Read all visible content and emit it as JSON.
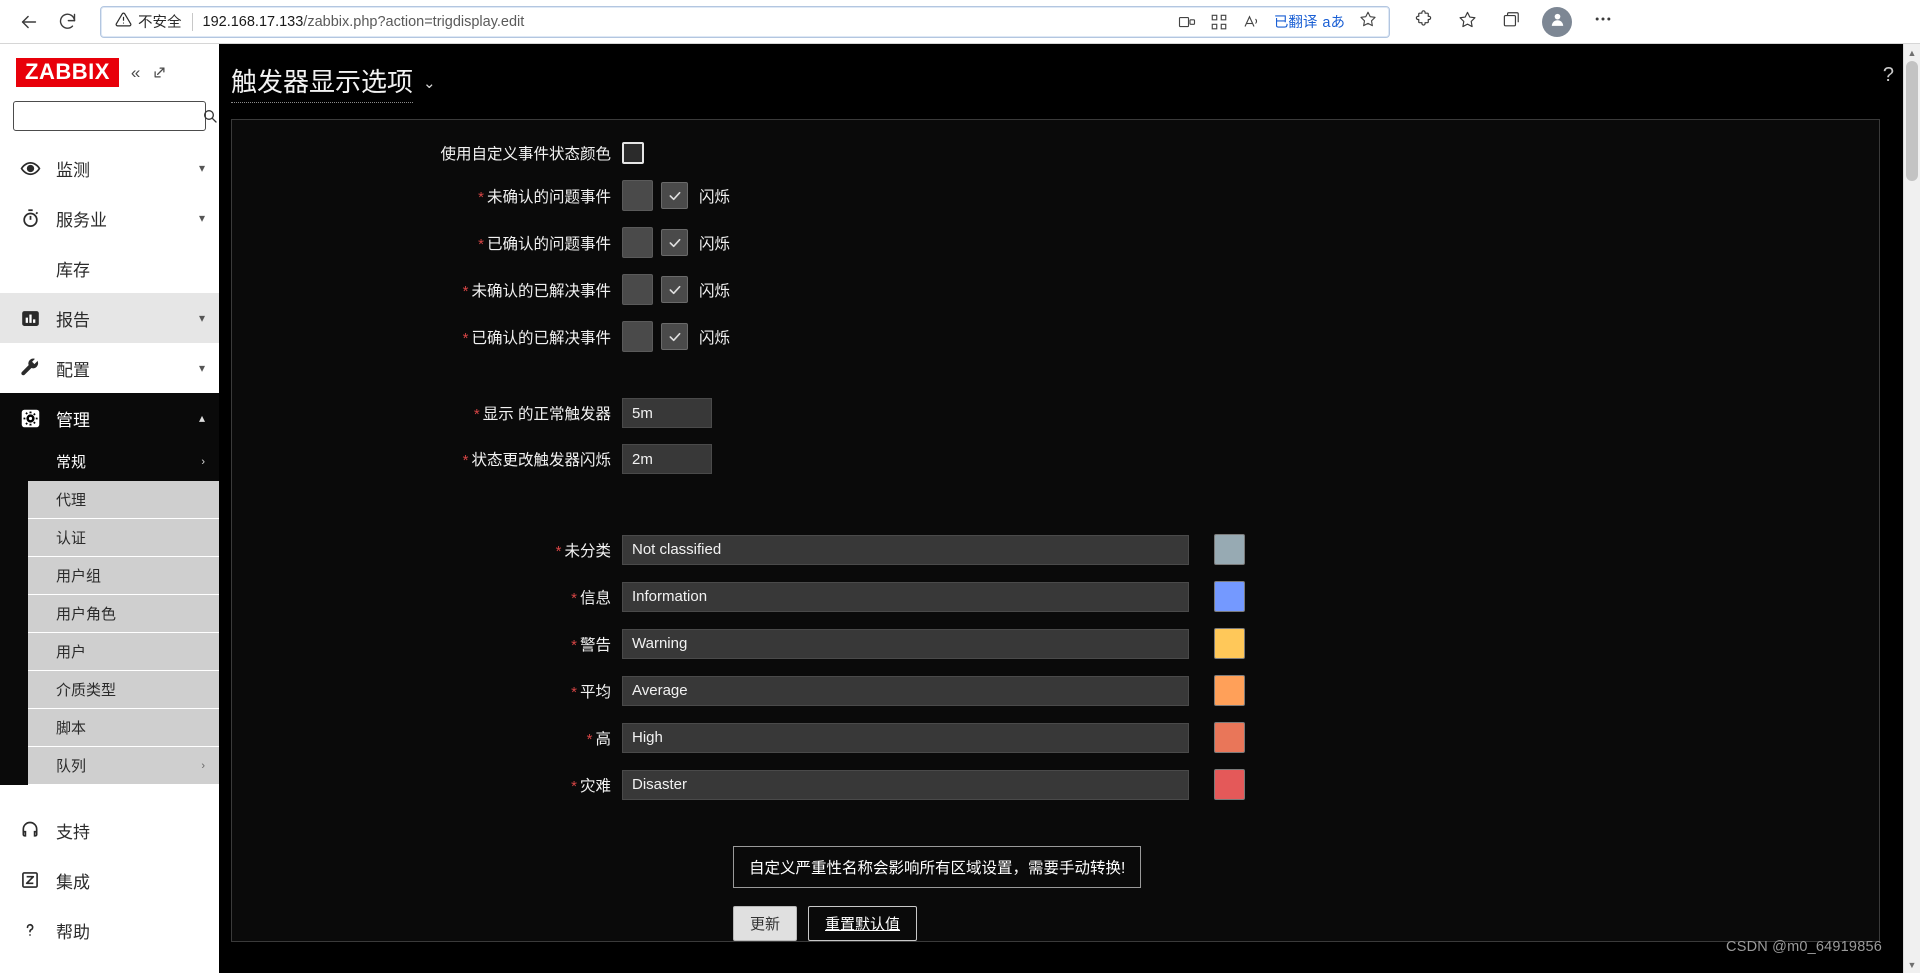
{
  "browser": {
    "back_icon": "back-arrow-icon",
    "reload_icon": "reload-icon",
    "security_warning": "不安全",
    "url_host": "192.168.17.133",
    "url_path": "/zabbix.php?action=trigdisplay.edit",
    "translated_label": "已翻译",
    "translated_glyph": "aあ",
    "icons": {
      "split_screen": "split-screen-icon",
      "collections": "collections-icon",
      "read_aloud": "read-aloud-icon",
      "favorite": "star-icon",
      "extensions": "puzzle-icon",
      "favorites_bar": "favorites-icon",
      "browser_tabs": "tab-actions-icon",
      "profile": "profile-avatar-icon",
      "settings_more": "more-options-icon"
    }
  },
  "sidebar": {
    "logo": "ZABBIX",
    "collapse_icon": "collapse-sidebar-icon",
    "pin_icon": "pin-sidebar-icon",
    "search_placeholder": "",
    "search_value": "",
    "search_icon": "search-icon",
    "items": [
      {
        "label": "监测",
        "icon": "eye-icon",
        "chevron": "chevron-down",
        "state": "normal"
      },
      {
        "label": "服务业",
        "icon": "stopwatch-icon",
        "chevron": "chevron-down",
        "state": "normal"
      },
      {
        "label": "库存",
        "icon": "",
        "chevron": "",
        "state": "normal"
      },
      {
        "label": "报告",
        "icon": "bar-chart-icon",
        "chevron": "chevron-down",
        "state": "hovered"
      },
      {
        "label": "配置",
        "icon": "wrench-icon",
        "chevron": "chevron-down",
        "state": "normal"
      },
      {
        "label": "管理",
        "icon": "gear-icon",
        "chevron": "chevron-up",
        "state": "active"
      }
    ],
    "submenu": [
      {
        "label": "常规",
        "chevron": "›",
        "selected": true
      },
      {
        "label": "代理",
        "chevron": "",
        "selected": false
      },
      {
        "label": "认证",
        "chevron": "",
        "selected": false
      },
      {
        "label": "用户组",
        "chevron": "",
        "selected": false
      },
      {
        "label": "用户角色",
        "chevron": "",
        "selected": false
      },
      {
        "label": "用户",
        "chevron": "",
        "selected": false
      },
      {
        "label": "介质类型",
        "chevron": "",
        "selected": false
      },
      {
        "label": "脚本",
        "chevron": "",
        "selected": false
      },
      {
        "label": "队列",
        "chevron": "›",
        "selected": false
      }
    ],
    "footer": [
      {
        "label": "支持",
        "icon": "lifebuoy-icon"
      },
      {
        "label": "集成",
        "icon": "zabbix-z-icon"
      },
      {
        "label": "帮助",
        "icon": "question-icon"
      }
    ]
  },
  "page": {
    "title": "触发器显示选项",
    "title_caret": "⌄",
    "help_icon": "?"
  },
  "form": {
    "use_custom_colors": {
      "label": "使用自定义事件状态颜色",
      "checked": false
    },
    "event_rows": [
      {
        "label": "未确认的问题事件",
        "required": true,
        "swatch": "#4a4a4a",
        "blink_checked": true,
        "blink_label": "闪烁"
      },
      {
        "label": "已确认的问题事件",
        "required": true,
        "swatch": "#4a4a4a",
        "blink_checked": true,
        "blink_label": "闪烁"
      },
      {
        "label": "未确认的已解决事件",
        "required": true,
        "swatch": "#4a4a4a",
        "blink_checked": true,
        "blink_label": "闪烁"
      },
      {
        "label": "已确认的已解决事件",
        "required": true,
        "swatch": "#4a4a4a",
        "blink_checked": true,
        "blink_label": "闪烁"
      }
    ],
    "timing_rows": [
      {
        "label": "显示 的正常触发器",
        "required": true,
        "value": "5m"
      },
      {
        "label": "状态更改触发器闪烁",
        "required": true,
        "value": "2m"
      }
    ],
    "severity_rows": [
      {
        "label": "未分类",
        "required": true,
        "value": "Not classified",
        "color": "#97aab3"
      },
      {
        "label": "信息",
        "required": true,
        "value": "Information",
        "color": "#7499ff"
      },
      {
        "label": "警告",
        "required": true,
        "value": "Warning",
        "color": "#ffc859"
      },
      {
        "label": "平均",
        "required": true,
        "value": "Average",
        "color": "#ffa059"
      },
      {
        "label": "高",
        "required": true,
        "value": "High",
        "color": "#e97659"
      },
      {
        "label": "灾难",
        "required": true,
        "value": "Disaster",
        "color": "#e45959"
      }
    ],
    "notice": "自定义严重性名称会影响所有区域设置，需要手动转换!",
    "buttons": {
      "update": "更新",
      "reset": "重置默认值"
    }
  },
  "watermark": "CSDN @m0_64919856"
}
